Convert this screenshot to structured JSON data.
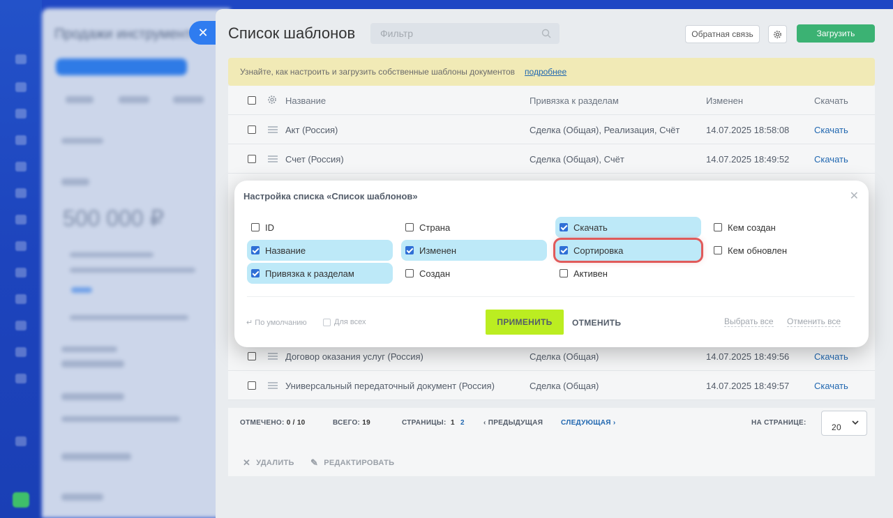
{
  "background": {
    "left_panel_title": "Продажи инструментов",
    "left_panel_amount": "500 000 ₽"
  },
  "slider": {
    "title": "Список шаблонов",
    "filter_placeholder": "Фильтр",
    "feedback_label": "Обратная связь",
    "upload_label": "Загрузить",
    "notice_text": "Узнайте, как настроить и загрузить собственные шаблоны документов",
    "notice_link": "подробнее"
  },
  "table": {
    "columns": [
      "Название",
      "Привязка к разделам",
      "Изменен",
      "Скачать"
    ],
    "rows": [
      {
        "name": "Акт (Россия)",
        "binding": "Сделка (Общая), Реализация, Счёт",
        "modified": "14.07.2025 18:58:08",
        "download": "Скачать"
      },
      {
        "name": "Счет (Россия)",
        "binding": "Сделка (Общая), Счёт",
        "modified": "14.07.2025 18:49:52",
        "download": "Скачать"
      },
      {
        "name": "Договор оказания услуг (Россия)",
        "binding": "Сделка (Общая)",
        "modified": "14.07.2025 18:49:56",
        "download": "Скачать"
      },
      {
        "name": "Универсальный передаточный документ (Россия)",
        "binding": "Сделка (Общая)",
        "modified": "14.07.2025 18:49:57",
        "download": "Скачать"
      }
    ]
  },
  "footer": {
    "checked_label": "ОТМЕЧЕНО:",
    "checked_value": "0 / 10",
    "total_label": "ВСЕГО:",
    "total_value": "19",
    "pages_label": "СТРАНИЦЫ:",
    "page1": "1",
    "page2": "2",
    "prev_label": "ПРЕДЫДУЩАЯ",
    "next_label": "СЛЕДУЮЩАЯ",
    "per_page_label": "НА СТРАНИЦЕ:",
    "per_page_value": "20"
  },
  "actions": {
    "delete_label": "УДАЛИТЬ",
    "edit_label": "РЕДАКТИРОВАТЬ"
  },
  "modal": {
    "title": "Настройка списка «Список шаблонов»",
    "options": [
      {
        "label": "ID",
        "checked": false
      },
      {
        "label": "Название",
        "checked": true
      },
      {
        "label": "Привязка к разделам",
        "checked": true
      },
      {
        "label": "Страна",
        "checked": false
      },
      {
        "label": "Изменен",
        "checked": true
      },
      {
        "label": "Создан",
        "checked": false
      },
      {
        "label": "Скачать",
        "checked": true
      },
      {
        "label": "Сортировка",
        "checked": true
      },
      {
        "label": "Активен",
        "checked": false
      },
      {
        "label": "Кем создан",
        "checked": false
      },
      {
        "label": "Кем обновлен",
        "checked": false
      }
    ],
    "default_label": "По умолчанию",
    "for_all_label": "Для всех",
    "apply_label": "ПРИМЕНИТЬ",
    "cancel_label": "ОТМЕНИТЬ",
    "select_all_label": "Выбрать все",
    "deselect_all_label": "Отменить все"
  }
}
